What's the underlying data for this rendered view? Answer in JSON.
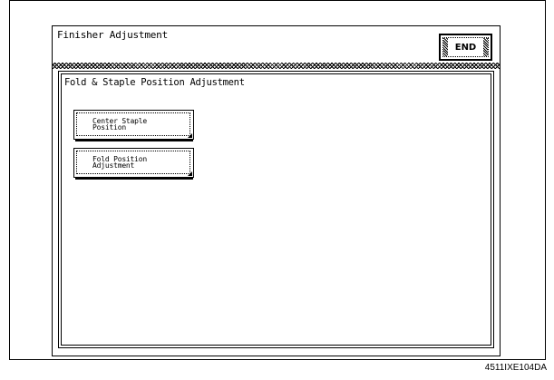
{
  "screen": {
    "title": "Finisher Adjustment",
    "end_label": "END"
  },
  "panel": {
    "title": "Fold & Staple Position Adjustment",
    "buttons": [
      {
        "label": "Center Staple\nPosition"
      },
      {
        "label": "Fold Position\nAdjustment"
      }
    ]
  },
  "figure_code": "4511IXE104DA"
}
